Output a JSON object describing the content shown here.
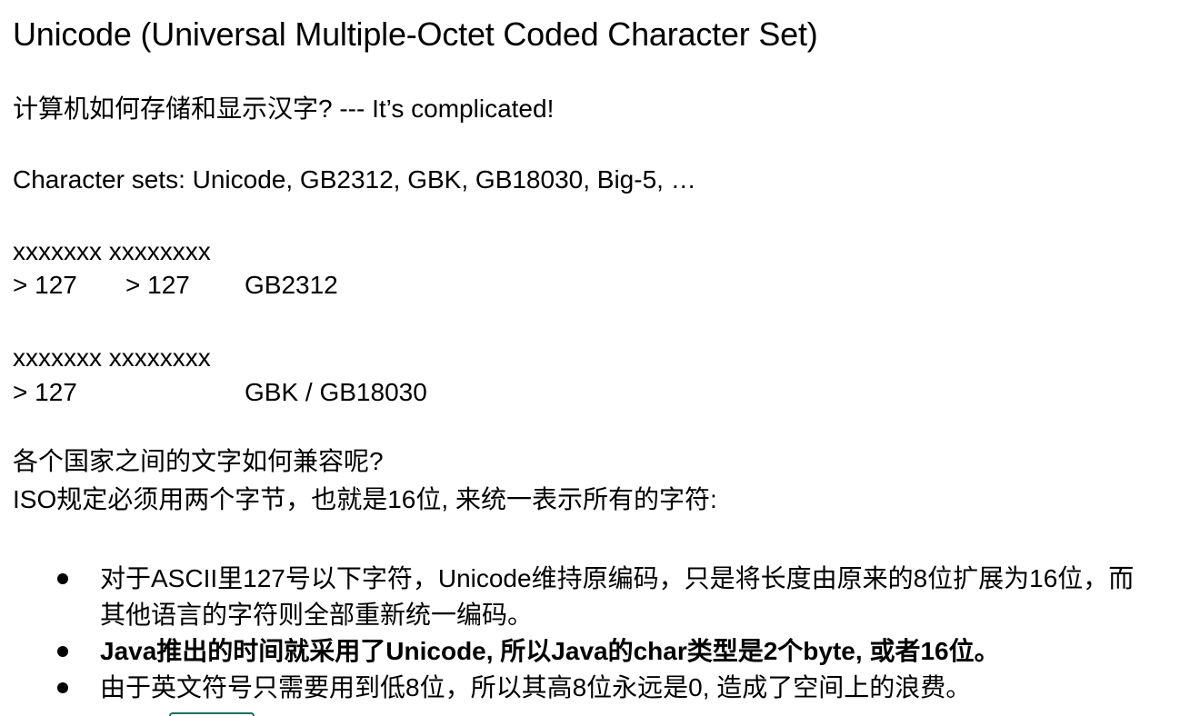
{
  "title": "Unicode (Universal Multiple-Octet Coded Character Set)",
  "question": "计算机如何存储和显示汉字? --- It’s complicated!",
  "charsets": "Character sets: Unicode, GB2312, GBK, GB18030, Big-5, …",
  "gb2312": {
    "bytes": "xxxxxxx xxxxxxxx",
    "first": "> 127",
    "second": "> 127",
    "name": "GB2312"
  },
  "gbk": {
    "bytes": "xxxxxxx xxxxxxxx",
    "first": "> 127",
    "name": "GBK / GB18030"
  },
  "compat_question": "各个国家之间的文字如何兼容呢?",
  "iso_rule": "ISO规定必须用两个字节，也就是16位, 来统一表示所有的字符:",
  "bullets": [
    "对于ASCII里127号以下字符，Unicode维持原编码，只是将长度由原来的8位扩展为16位，而其他语言的字符则全部重新统一编码。",
    "Java推出的时间就采用了Unicode, 所以Java的char类型是2个byte, 或者16位。",
    "由于英文符号只需要用到低8位，所以其高8位永远是0, 造成了空间上的浪费。"
  ],
  "colors": {
    "text": "#000000",
    "background": "#ffffff",
    "accent": "#1a6e62"
  }
}
